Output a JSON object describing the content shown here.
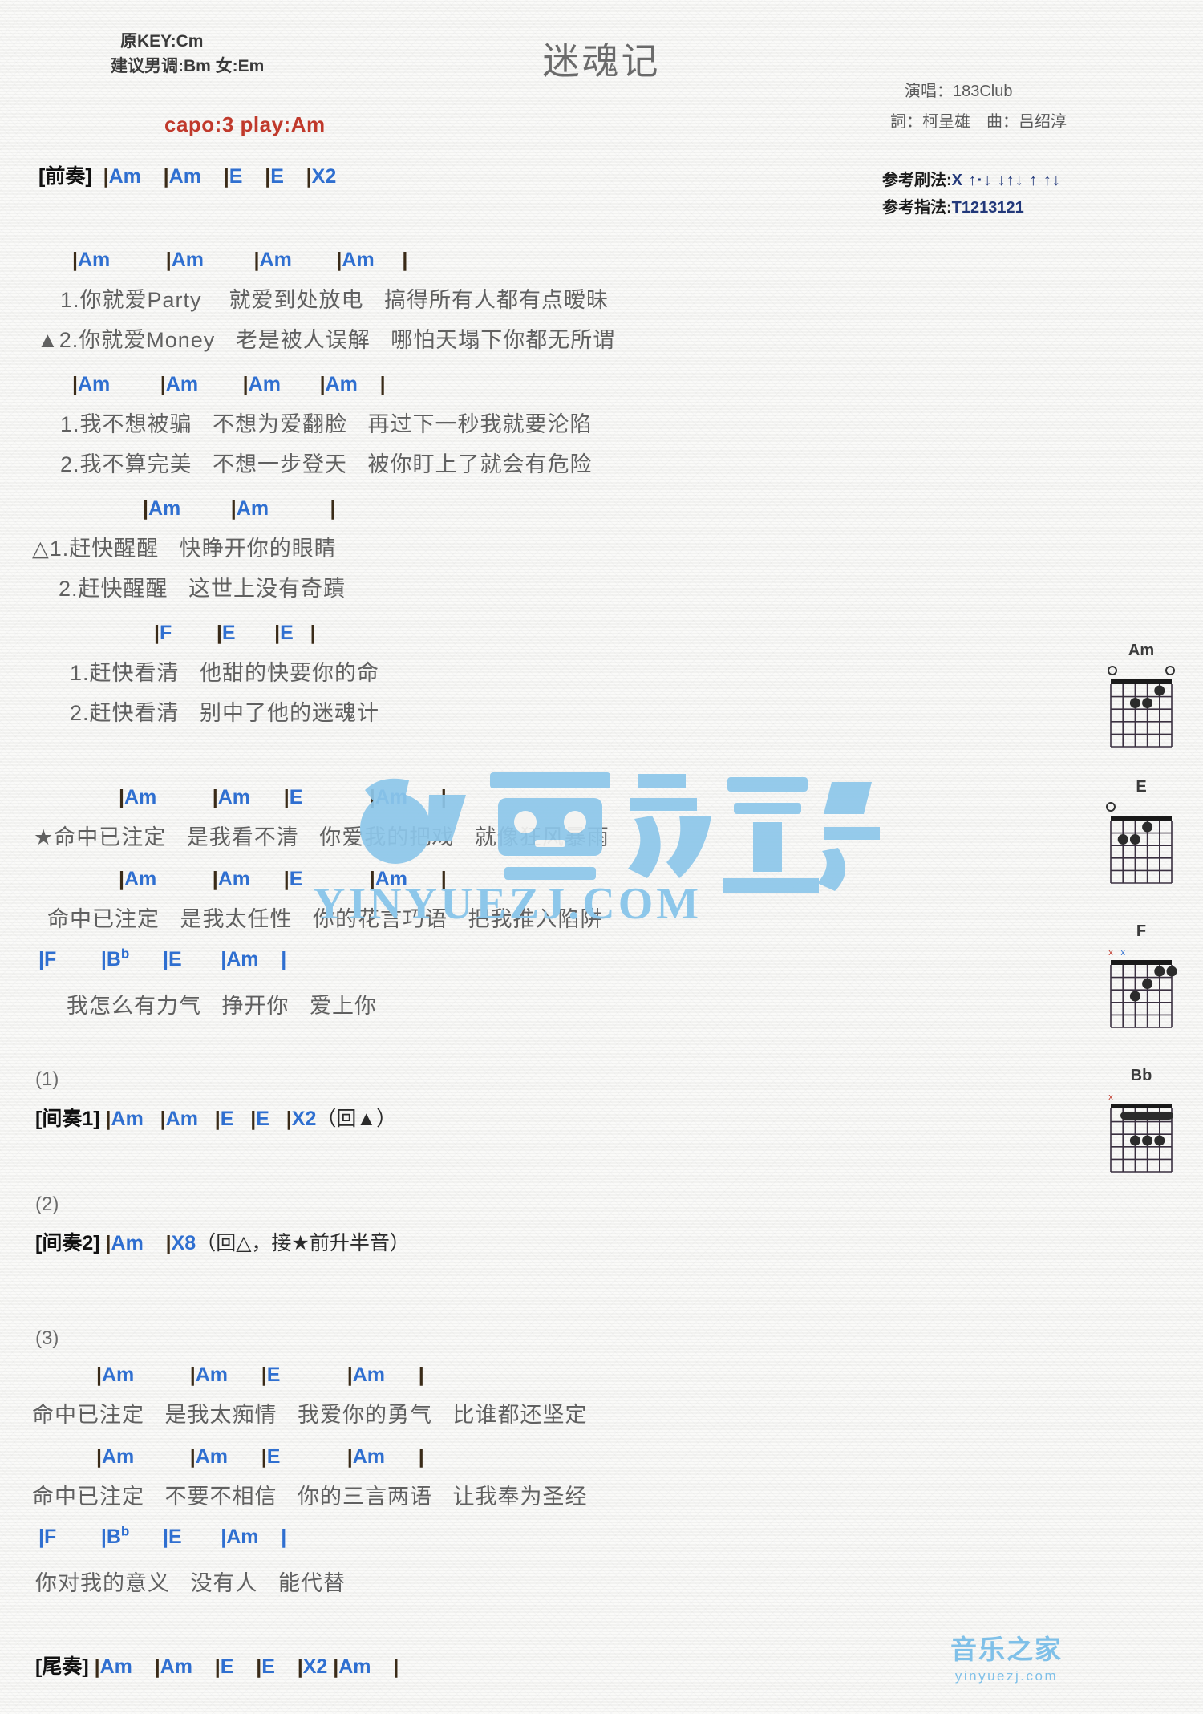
{
  "header": {
    "original_key": "原KEY:Cm",
    "suggested_key": "建议男调:Bm 女:Em",
    "capo": "capo:3 play:Am",
    "title": "迷魂记",
    "singer": "演唱：183Club",
    "writers": "詞：柯呈雄　曲：吕绍淳",
    "strum_label": "参考刷法:",
    "strum_value": "X ↑·↓ ↓↑↓ ↑ ↑↓",
    "strum_value_raw": "X ↑·↓ _↓↑↓ ↑_↑↓",
    "finger_label": "参考指法:",
    "finger_value": "T1213121"
  },
  "intro": {
    "label": "[前奏]",
    "chords": "|Am    |Am    |E    |E    |X2"
  },
  "sections": [
    {
      "name": "verse-1a",
      "chords": "|Am          |Am         |Am        |Am     |",
      "lyrics": [
        "  1.你就爱Party    就爱到处放电   搞得所有人都有点暧昧",
        "▲2.你就爱Money   老是被人误解   哪怕天塌下你都无所谓"
      ]
    },
    {
      "name": "verse-1b",
      "chords": "|Am         |Am        |Am       |Am    |",
      "lyrics": [
        "  1.我不想被骗   不想为爱翻脸   再过下一秒我就要沦陷",
        "  2.我不算完美   不想一步登天   被你盯上了就会有危险"
      ]
    },
    {
      "name": "pre-chorus-a",
      "chords": "|Am         |Am           |",
      "lyrics": [
        "△1.赶快醒醒   快睁开你的眼睛",
        "  2.赶快醒醒   这世上没有奇蹟"
      ]
    },
    {
      "name": "pre-chorus-b",
      "chords": "|F        |E       |E   |",
      "lyrics": [
        "  1.赶快看清   他甜的快要你的命",
        "  2.赶快看清   别中了他的迷魂计"
      ]
    }
  ],
  "chorus": {
    "lines": [
      {
        "chords": "|Am          |Am      |E            |Am      |",
        "lyric": "★命中已注定   是我看不清   你爱我的把戏   就像狂风暴雨"
      },
      {
        "chords": "|Am          |Am      |E            |Am      |",
        "lyric": "  命中已注定   是我太任性   你的花言巧语   把我推入陷阱"
      },
      {
        "chords": "|F        |Bb      |E       |Am    |",
        "lyric": "  我怎么有力气   挣开你   爱上你"
      }
    ]
  },
  "interlude1": {
    "number": "(1)",
    "label": "[间奏1]",
    "chords": "|Am   |Am   |E   |E   |X2",
    "note": "（回▲）"
  },
  "interlude2": {
    "number": "(2)",
    "label": "[间奏2]",
    "chords": "|Am    |X8",
    "note": "（回△，接★前升半音）"
  },
  "final": {
    "number": "(3)",
    "lines": [
      {
        "chords": "|Am          |Am      |E            |Am      |",
        "lyric": "命中已注定   是我太痴情   我爱你的勇气   比谁都还坚定"
      },
      {
        "chords": "|Am          |Am      |E            |Am      |",
        "lyric": "命中已注定   不要不相信   你的三言两语   让我奉为圣经"
      },
      {
        "chords": "|F        |Bb      |E       |Am    |",
        "lyric": "你对我的意义   没有人   能代替"
      }
    ]
  },
  "outro": {
    "label": "[尾奏]",
    "chords": "|Am    |Am    |E    |E    |X2 |Am    |"
  },
  "diagrams": [
    {
      "name": "Am",
      "markers": [
        "",
        "o",
        "",
        "",
        "",
        "o"
      ],
      "dots": [
        {
          "string": 2,
          "fret": 2
        },
        {
          "string": 3,
          "fret": 2
        },
        {
          "string": 4,
          "fret": 1
        }
      ],
      "barre": null
    },
    {
      "name": "E",
      "markers": [
        "o",
        "",
        "",
        "",
        "",
        ""
      ],
      "dots": [
        {
          "string": 1,
          "fret": 2
        },
        {
          "string": 2,
          "fret": 2
        },
        {
          "string": 3,
          "fret": 1
        }
      ],
      "barre": null
    },
    {
      "name": "F",
      "markers": [
        "x",
        "x",
        "",
        "",
        "",
        ""
      ],
      "dots": [
        {
          "string": 1,
          "fret": 3
        },
        {
          "string": 2,
          "fret": 2
        },
        {
          "string": 4,
          "fret": 1
        },
        {
          "string": 5,
          "fret": 1
        }
      ],
      "barre": null
    },
    {
      "name": "Bb",
      "markers": [
        "x",
        "",
        "",
        "",
        "",
        ""
      ],
      "dots": [
        {
          "string": 2,
          "fret": 3
        },
        {
          "string": 3,
          "fret": 3
        },
        {
          "string": 4,
          "fret": 3
        }
      ],
      "barre": {
        "fret": 1,
        "from": 1,
        "to": 5
      }
    }
  ],
  "watermark": {
    "text": "音樂之家",
    "domain": "YINYUEZJ.COM",
    "footer_text": "音乐之家",
    "footer_domain": "yinyuezj.com"
  },
  "colors": {
    "chord": "#2f6fd0",
    "lyric": "#606060",
    "capo": "#c0392b",
    "title": "#6b6b6b",
    "watermark": "#8dc7ea"
  }
}
